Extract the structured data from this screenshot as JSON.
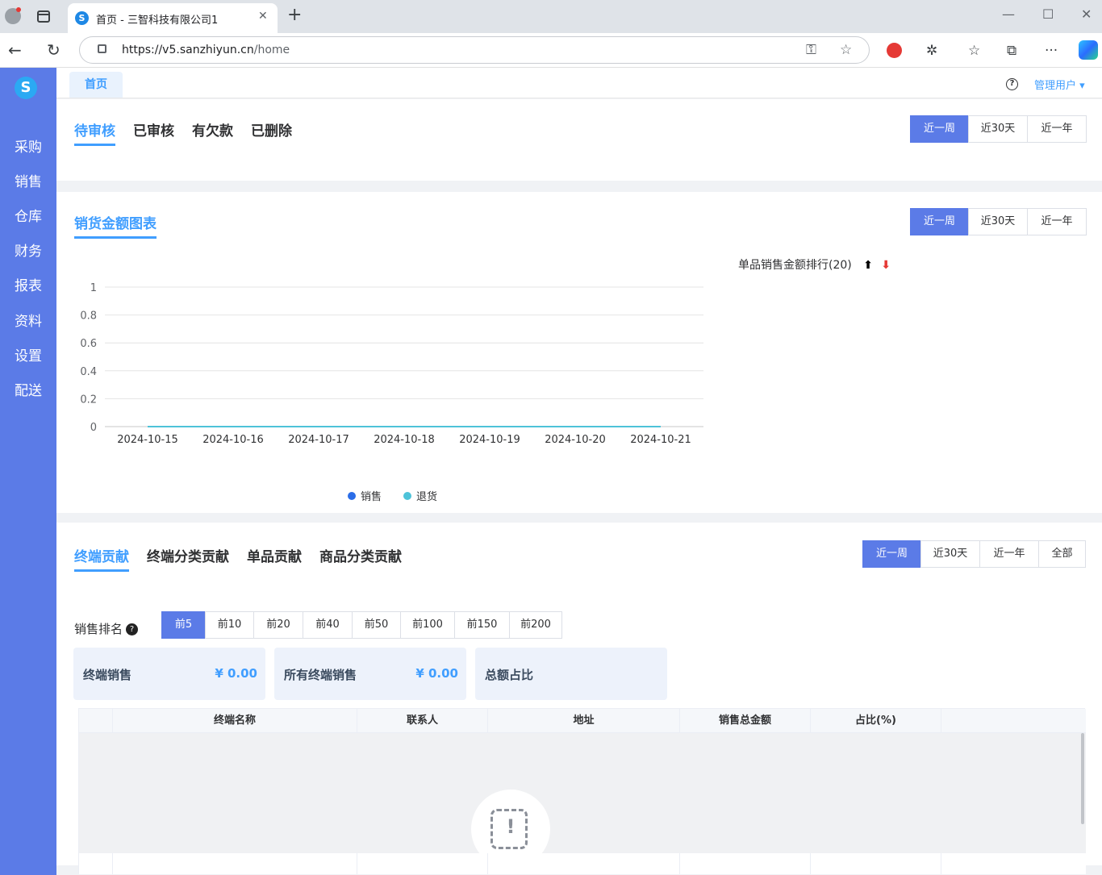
{
  "browser": {
    "tab_title": "首页 - 三智科技有限公司1",
    "url_host": "https://v5.sanzhiyun.cn",
    "url_path": "/home"
  },
  "sidebar": {
    "logo": "S",
    "items": [
      {
        "label": "采购"
      },
      {
        "label": "销售"
      },
      {
        "label": "仓库"
      },
      {
        "label": "财务"
      },
      {
        "label": "报表"
      },
      {
        "label": "资料"
      },
      {
        "label": "设置"
      },
      {
        "label": "配送"
      }
    ]
  },
  "topnav": {
    "home_tab": "首页",
    "user_label": "管理用户 ▾"
  },
  "review": {
    "tabs": [
      "待审核",
      "已审核",
      "有欠款",
      "已删除"
    ],
    "active_tab": 0,
    "periods": [
      "近一周",
      "近30天",
      "近一年"
    ],
    "active_period": 0
  },
  "sales_chart": {
    "tab": "销货金额图表",
    "periods": [
      "近一周",
      "近30天",
      "近一年"
    ],
    "active_period": 0,
    "rank_title": "单品销售金额排行(20)",
    "rank_up": "⬆",
    "rank_down": "⬇"
  },
  "chart_data": {
    "type": "line",
    "x": [
      "2024-10-15",
      "2024-10-16",
      "2024-10-17",
      "2024-10-18",
      "2024-10-19",
      "2024-10-20",
      "2024-10-21"
    ],
    "yticks": [
      "0",
      "0.2",
      "0.4",
      "0.6",
      "0.8",
      "1"
    ],
    "ylim": [
      0,
      1
    ],
    "grid": true,
    "legend_position": "bottom",
    "series": [
      {
        "name": "销售",
        "color": "#2b6de8",
        "values": [
          0,
          0,
          0,
          0,
          0,
          0,
          0
        ]
      },
      {
        "name": "退货",
        "color": "#4ec3d9",
        "values": [
          0,
          0,
          0,
          0,
          0,
          0,
          0
        ]
      }
    ]
  },
  "contribution": {
    "tabs": [
      "终端贡献",
      "终端分类贡献",
      "单品贡献",
      "商品分类贡献"
    ],
    "active_tab": 0,
    "periods": [
      "近一周",
      "近30天",
      "近一年",
      "全部"
    ],
    "active_period": 0,
    "rank_label": "销售排名",
    "rank_help": "?",
    "topn": [
      "前5",
      "前10",
      "前20",
      "前40",
      "前50",
      "前100",
      "前150",
      "前200"
    ],
    "active_topn": 0,
    "stats": [
      {
        "label": "终端销售",
        "value": "¥ 0.00"
      },
      {
        "label": "所有终端销售",
        "value": "¥ 0.00"
      },
      {
        "label": "总额占比",
        "value": ""
      }
    ],
    "table": {
      "columns": [
        "",
        "终端名称",
        "联系人",
        "地址",
        "销售总金额",
        "占比(%)",
        ""
      ],
      "rows": [],
      "empty_icon": "!"
    }
  },
  "colors": {
    "sidebar": "#5b7be7",
    "accent": "#409eff",
    "active_button": "#5b7be7"
  }
}
